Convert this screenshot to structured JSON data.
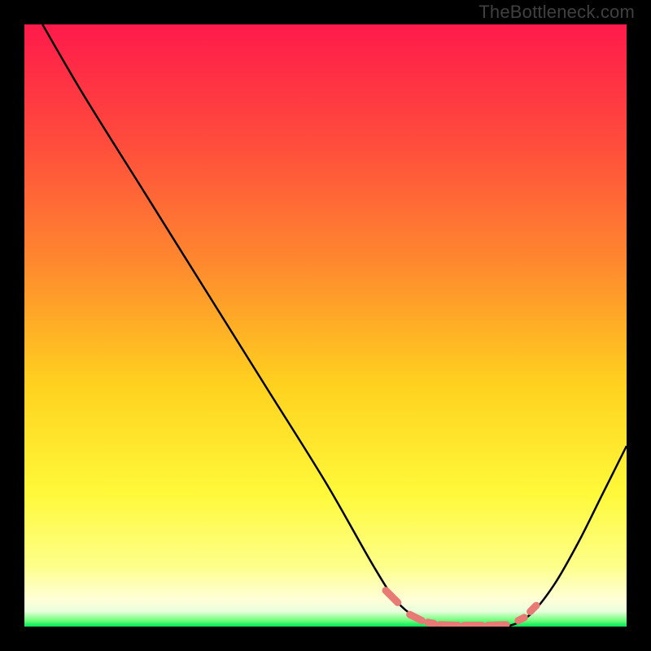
{
  "attribution": "TheBottleneck.com",
  "chart_data": {
    "type": "line",
    "title": "",
    "xlabel": "",
    "ylabel": "",
    "xlim": [
      0,
      100
    ],
    "ylim": [
      0,
      100
    ],
    "gradient_stops": [
      {
        "offset": 0.0,
        "color": "#ff1a4b"
      },
      {
        "offset": 0.2,
        "color": "#ff4d3c"
      },
      {
        "offset": 0.4,
        "color": "#ff8a2e"
      },
      {
        "offset": 0.6,
        "color": "#ffd21f"
      },
      {
        "offset": 0.78,
        "color": "#fff93a"
      },
      {
        "offset": 0.9,
        "color": "#fdff8a"
      },
      {
        "offset": 0.955,
        "color": "#ffffd8"
      },
      {
        "offset": 0.975,
        "color": "#e8ffdc"
      },
      {
        "offset": 0.99,
        "color": "#6eff7a"
      },
      {
        "offset": 1.0,
        "color": "#00e658"
      }
    ],
    "series": [
      {
        "name": "bottleneck-curve",
        "points": [
          {
            "x": 3,
            "y": 100
          },
          {
            "x": 10,
            "y": 88
          },
          {
            "x": 20,
            "y": 72
          },
          {
            "x": 30,
            "y": 56
          },
          {
            "x": 40,
            "y": 40
          },
          {
            "x": 50,
            "y": 24
          },
          {
            "x": 58,
            "y": 10
          },
          {
            "x": 62,
            "y": 4
          },
          {
            "x": 66,
            "y": 1
          },
          {
            "x": 70,
            "y": 0
          },
          {
            "x": 75,
            "y": 0
          },
          {
            "x": 80,
            "y": 0
          },
          {
            "x": 84,
            "y": 2
          },
          {
            "x": 88,
            "y": 7
          },
          {
            "x": 92,
            "y": 14
          },
          {
            "x": 96,
            "y": 22
          },
          {
            "x": 100,
            "y": 30
          }
        ]
      }
    ],
    "highlight_band": {
      "color": "#e77a74",
      "segments": [
        {
          "x0": 60,
          "y0": 6,
          "x1": 62,
          "y1": 4
        },
        {
          "x0": 64,
          "y0": 2,
          "x1": 66,
          "y1": 1
        },
        {
          "x0": 67,
          "y0": 0.7,
          "x1": 68,
          "y1": 0.5
        },
        {
          "x0": 69,
          "y0": 0.3,
          "x1": 72,
          "y1": 0.2
        },
        {
          "x0": 73,
          "y0": 0.2,
          "x1": 76,
          "y1": 0.2
        },
        {
          "x0": 77,
          "y0": 0.2,
          "x1": 80,
          "y1": 0.3
        },
        {
          "x0": 82,
          "y0": 1,
          "x1": 83,
          "y1": 1.5
        },
        {
          "x0": 84,
          "y0": 2.5,
          "x1": 85,
          "y1": 3.5
        }
      ]
    }
  }
}
